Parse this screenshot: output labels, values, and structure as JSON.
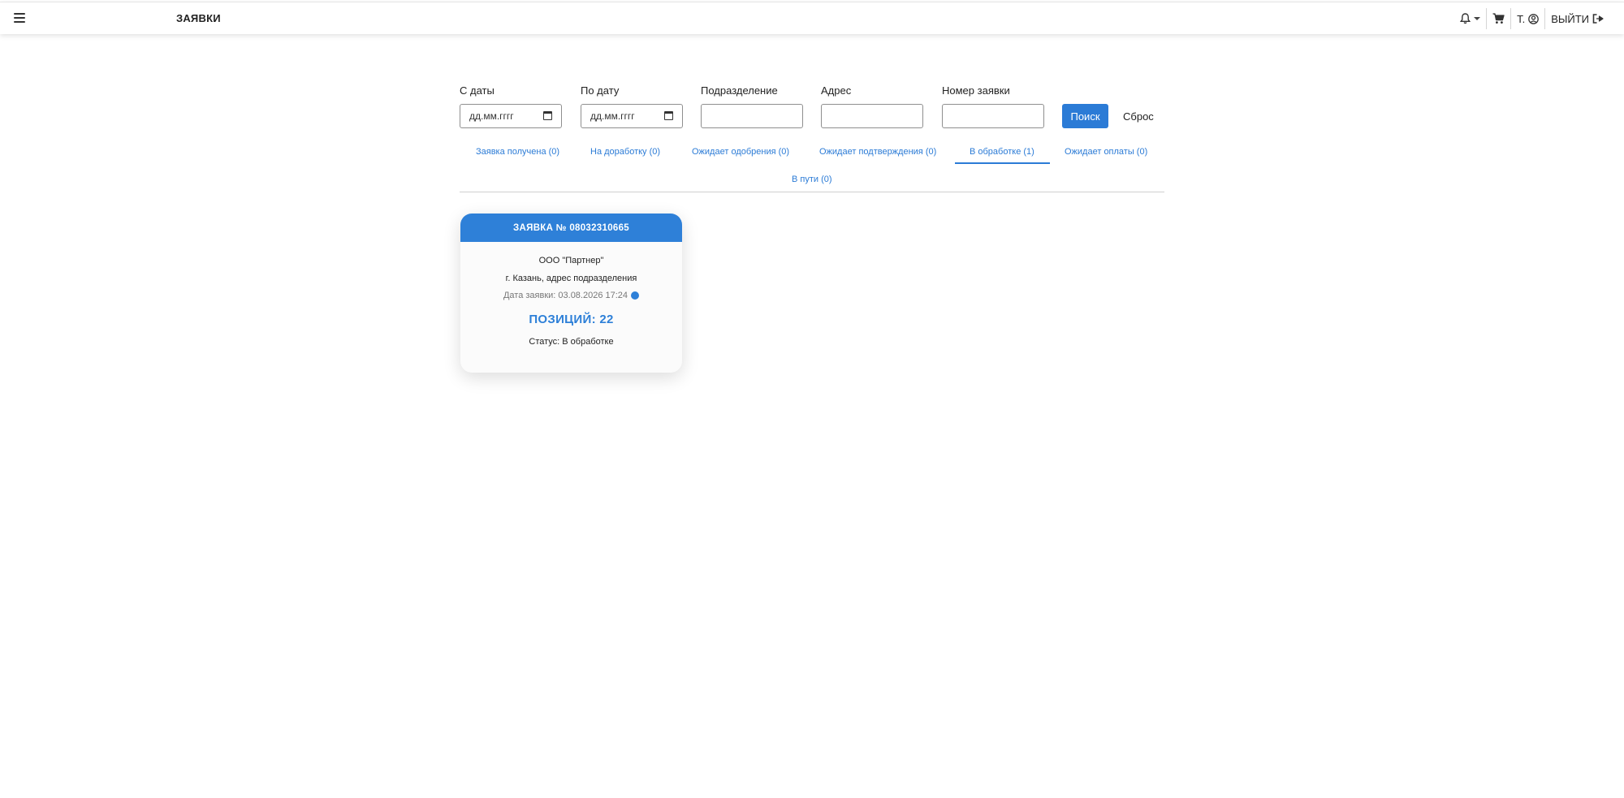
{
  "header": {
    "title": "ЗАЯВКИ",
    "user_initial": "Т.",
    "logout_label": "ВЫЙТИ"
  },
  "filters": {
    "from_date_label": "С даты",
    "from_date_placeholder": "дд.мм.гггг",
    "to_date_label": "По дату",
    "to_date_placeholder": "дд.мм.гггг",
    "division_label": "Подразделение",
    "division_value": "",
    "address_label": "Адрес",
    "address_value": "",
    "order_number_label": "Номер заявки",
    "order_number_value": "",
    "search_label": "Поиск",
    "reset_label": "Сброс"
  },
  "tabs": [
    {
      "label": "Заявка получена (0)",
      "active": false
    },
    {
      "label": "На доработку (0)",
      "active": false
    },
    {
      "label": "Ожидает одобрения (0)",
      "active": false
    },
    {
      "label": "Ожидает подтверждения (0)",
      "active": false
    },
    {
      "label": "В обработке (1)",
      "active": true
    },
    {
      "label": "Ожидает оплаты (0)",
      "active": false
    },
    {
      "label": "В пути (0)",
      "active": false
    }
  ],
  "orders": [
    {
      "title": "ЗАЯВКА № 08032310665",
      "company": "ООО \"Партнер\"",
      "address": "г. Казань, адрес подразделения",
      "date": "Дата заявки: 03.08.2026 17:24",
      "positions": "ПОЗИЦИЙ: 22",
      "status": "Статус: В обработке"
    }
  ],
  "colors": {
    "accent": "#2b7bd6",
    "card_header": "#2e80d8"
  }
}
